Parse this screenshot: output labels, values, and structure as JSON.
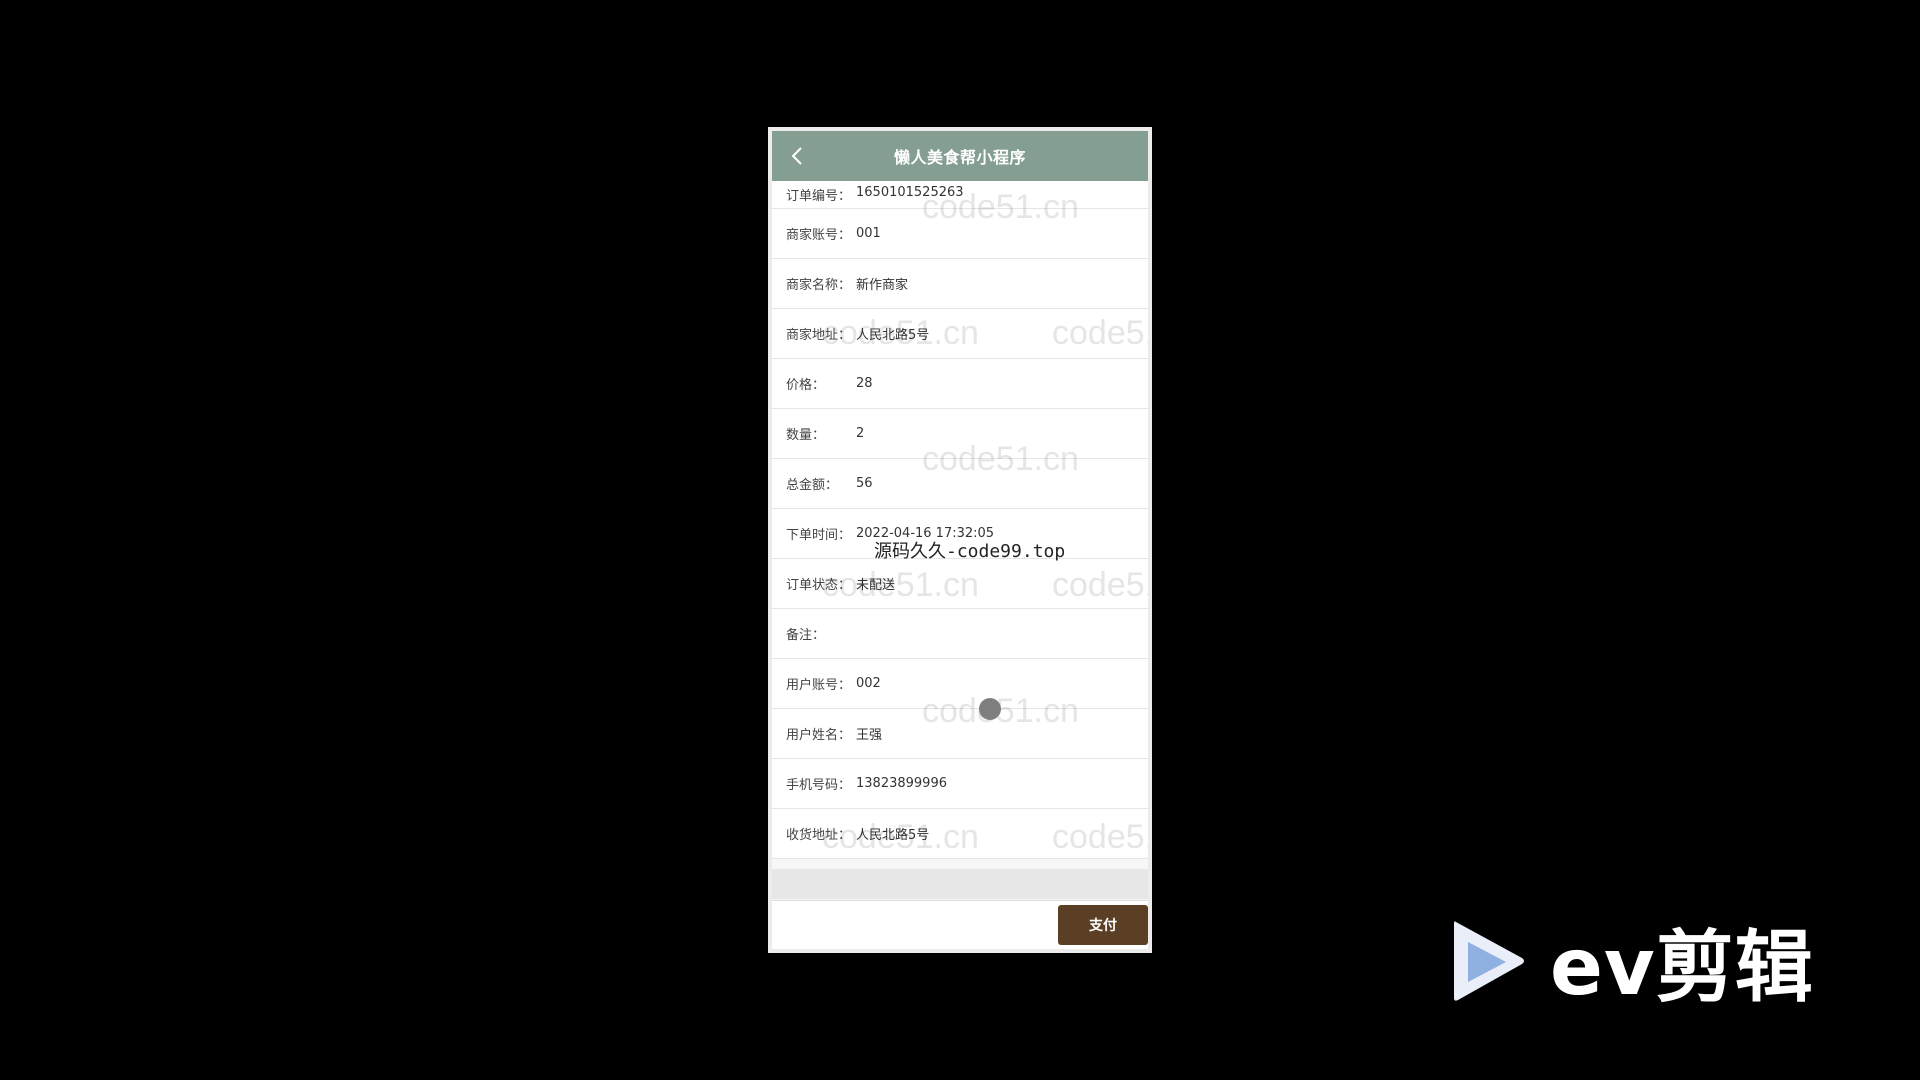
{
  "app": {
    "title": "懒人美食帮小程序",
    "back_icon": "chevron-left-icon"
  },
  "fields": [
    {
      "label": "订单编号：",
      "value": "1650101525263"
    },
    {
      "label": "商家账号：",
      "value": "001"
    },
    {
      "label": "商家名称：",
      "value": "新作商家"
    },
    {
      "label": "商家地址：",
      "value": "人民北路5号"
    },
    {
      "label": "价格：",
      "value": "28"
    },
    {
      "label": "数量：",
      "value": "2"
    },
    {
      "label": "总金额：",
      "value": "56"
    },
    {
      "label": "下单时间：",
      "value": "2022-04-16 17:32:05"
    },
    {
      "label": "订单状态：",
      "value": "未配送"
    },
    {
      "label": "备注：",
      "value": ""
    },
    {
      "label": "用户账号：",
      "value": "002"
    },
    {
      "label": "用户姓名：",
      "value": "王强"
    },
    {
      "label": "手机号码：",
      "value": "13823899996"
    },
    {
      "label": "收货地址：",
      "value": "人民北路5号"
    }
  ],
  "footer": {
    "pay_label": "支付"
  },
  "watermarks": {
    "repeated": "code51.cn",
    "overlay": "源码久久-code99.top"
  },
  "branding": {
    "logo_text": "ev剪辑"
  },
  "colors": {
    "navbar": "#859e92",
    "pay_button": "#5b3f24",
    "background": "#000000"
  }
}
